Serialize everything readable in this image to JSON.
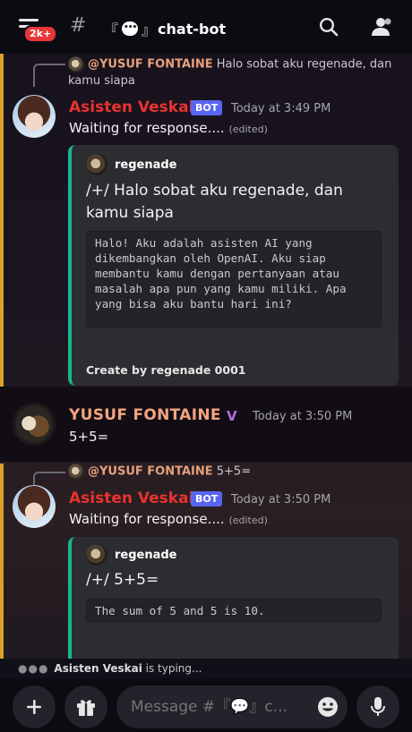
{
  "header": {
    "badge": "2k+",
    "hash": "#",
    "channel_open": "『",
    "channel_close": "』",
    "channel_name": "chat-bot"
  },
  "messages": [
    {
      "reply_name": "@YUSUF FONTAINE",
      "reply_text": "Halo sobat aku regenade, dan kamu siapa",
      "author": "Asisten Veskai",
      "badge": "BOT",
      "time": "Today at 3:49 PM",
      "text": "Waiting for response....",
      "edited": "(edited)",
      "embed": {
        "author": "regenade",
        "title": "/+/ Halo sobat aku regenade, dan kamu siapa",
        "code": "Halo! Aku adalah asisten AI yang dikembangkan oleh OpenAI. Aku siap membantu kamu dengan pertanyaan atau masalah apa pun yang kamu miliki. Apa yang bisa aku bantu hari ini?",
        "footer": "Create by regenade 0001"
      }
    },
    {
      "author": "YUSUF FONTAINE",
      "time": "Today at 3:50 PM",
      "text": "5+5="
    },
    {
      "reply_name": "@YUSUF FONTAINE",
      "reply_text": "5+5=",
      "author": "Asisten Veskai",
      "badge": "BOT",
      "time": "Today at 3:50 PM",
      "text": "Waiting for response....",
      "edited": "(edited)",
      "embed": {
        "author": "regenade",
        "title": "/+/ 5+5=",
        "code": "The sum of 5 and 5 is 10."
      }
    }
  ],
  "typing": {
    "name": "Asisten Veskai",
    "suffix": " is typing..."
  },
  "composer": {
    "placeholder": "Message #『💬』c..."
  },
  "icons": {
    "menu": "menu-icon",
    "search": "search-icon",
    "members": "members-icon",
    "add": "plus-icon",
    "gift": "gift-icon",
    "emoji": "emoji-icon",
    "mic": "mic-icon"
  },
  "colors": {
    "bot_name": "#e8332f",
    "user_name": "#f3a47f",
    "bot_badge": "#5865f2",
    "embed_accent": "#19b58f",
    "highlight_bar": "#d9a02a"
  }
}
